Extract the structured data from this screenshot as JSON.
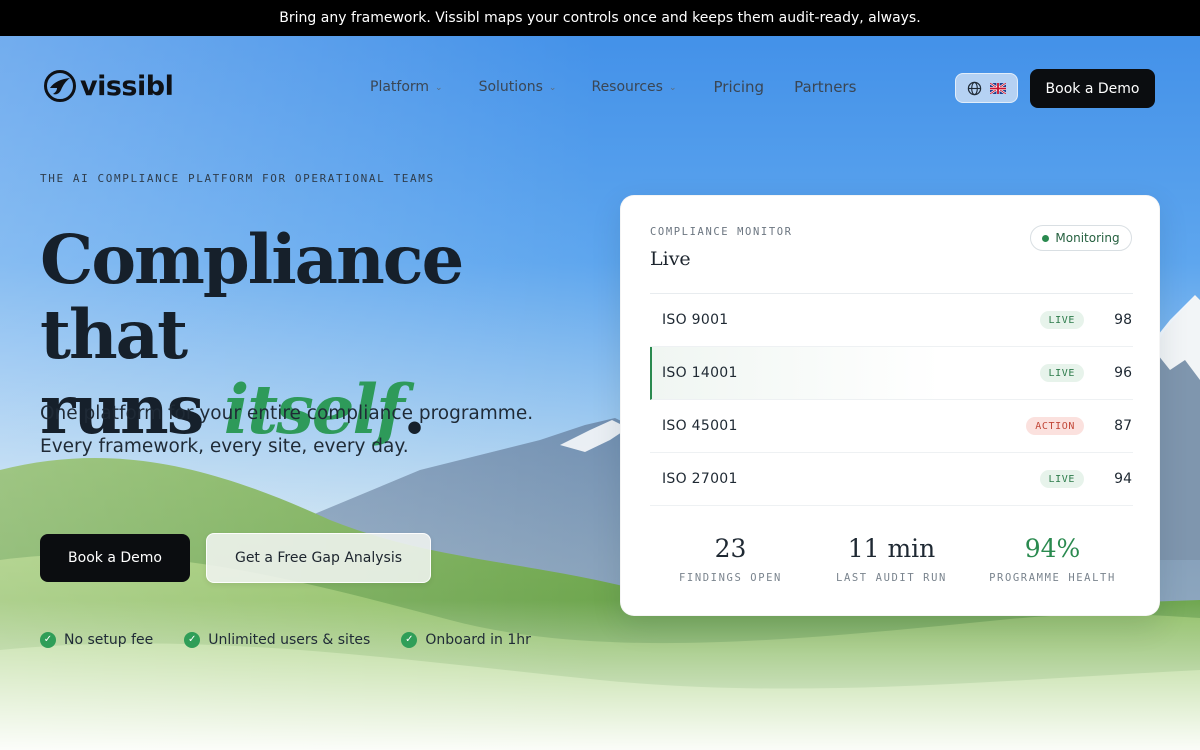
{
  "announcement": "Bring any framework. Vissibl maps your controls once and keeps them audit-ready, always.",
  "brand": {
    "name": "vissibl"
  },
  "nav": {
    "items": [
      {
        "label": "Platform",
        "has_dropdown": true
      },
      {
        "label": "Solutions",
        "has_dropdown": true
      },
      {
        "label": "Resources",
        "has_dropdown": true
      },
      {
        "label": "Pricing",
        "has_dropdown": false
      },
      {
        "label": "Partners",
        "has_dropdown": false
      }
    ],
    "language_icons": [
      "globe-icon",
      "uk-flag-icon"
    ],
    "cta_label": "Book a Demo"
  },
  "hero": {
    "eyebrow": "THE AI COMPLIANCE PLATFORM FOR OPERATIONAL TEAMS",
    "headline_line1": "Compliance that",
    "headline_line2_start": "runs ",
    "headline_accent": "itself",
    "headline_end": ".",
    "subhead": "One platform for your entire compliance programme. Every framework, every site, every day.",
    "primary_cta": "Book a Demo",
    "secondary_cta": "Get a Free Gap Analysis",
    "perks": [
      "No setup fee",
      "Unlimited users & sites",
      "Onboard in 1hr"
    ]
  },
  "card": {
    "eyebrow": "COMPLIANCE MONITOR",
    "title": "Live",
    "status": "Monitoring",
    "rows": [
      {
        "name": "ISO 9001",
        "badge": "LIVE",
        "badge_type": "live",
        "score": "98"
      },
      {
        "name": "ISO 14001",
        "badge": "LIVE",
        "badge_type": "live",
        "score": "96"
      },
      {
        "name": "ISO 45001",
        "badge": "ACTION",
        "badge_type": "action",
        "score": "87"
      },
      {
        "name": "ISO 27001",
        "badge": "LIVE",
        "badge_type": "live",
        "score": "94"
      }
    ],
    "stats": [
      {
        "value": "23",
        "label": "FINDINGS OPEN"
      },
      {
        "value": "11 min",
        "label": "LAST AUDIT RUN"
      },
      {
        "value": "94%",
        "label": "PROGRAMME HEALTH"
      }
    ]
  },
  "colors": {
    "accent_green": "#2e9a5a",
    "dark_button": "#0b0d10",
    "action_red": "#c24738"
  }
}
